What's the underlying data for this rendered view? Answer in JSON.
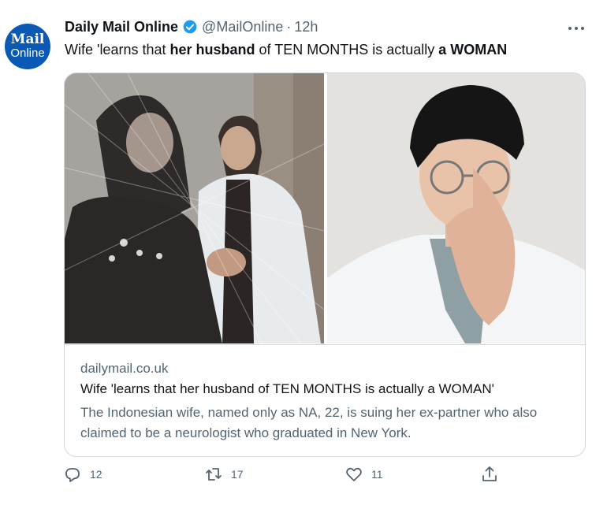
{
  "tweet": {
    "avatar_line1": "Mail",
    "avatar_line2": "Online",
    "name": "Daily Mail Online",
    "handle": "@MailOnline",
    "separator": "·",
    "time": "12h",
    "text_parts": [
      "Wife 'learns that ",
      "her husband",
      " of TEN MONTHS is actually ",
      "a WOMAN"
    ]
  },
  "card": {
    "domain": "dailymail.co.uk",
    "title": "Wife 'learns that her husband of TEN MONTHS is actually a WOMAN'",
    "description": "The Indonesian wife, named only as NA, 22, is suing her ex-partner who also claimed to be a neurologist who graduated in New York."
  },
  "actions": {
    "reply_count": "12",
    "retweet_count": "17",
    "like_count": "11"
  },
  "icons": {
    "verified": "verified-badge-icon",
    "more": "more-icon",
    "reply": "reply-icon",
    "retweet": "retweet-icon",
    "like": "like-icon",
    "share": "share-icon"
  },
  "colors": {
    "avatar_bg": "#0a5ab5",
    "verified": "#1d9bf0",
    "secondary_text": "#536471"
  }
}
